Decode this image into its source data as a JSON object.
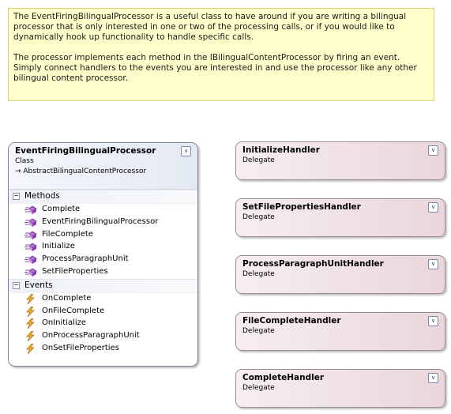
{
  "note": {
    "paragraphs": [
      "The EventFiringBilingualProcessor is a useful class to have around if you are writing a bilingual processor that is only interested in one or two of the processing calls, or if you would like to dynamically hook up functionality to handle specific calls.",
      "The processor implements each method in the IBilingualContentProcessor by firing an event. Simply connect handlers to the events you are interested in and use the processor like any other bilingual content processor."
    ]
  },
  "class_shape": {
    "name": "EventFiringBilingualProcessor",
    "stereotype": "Class",
    "base_class": "→ AbstractBilingualContentProcessor",
    "collapse_glyph": "∧",
    "sections": {
      "methods": {
        "label": "Methods",
        "toggle": "−",
        "items": [
          "Complete",
          "EventFiringBilingualProcessor",
          "FileComplete",
          "Initialize",
          "ProcessParagraphUnit",
          "SetFileProperties"
        ]
      },
      "events": {
        "label": "Events",
        "toggle": "−",
        "items": [
          "OnComplete",
          "OnFileComplete",
          "OnInitialize",
          "OnProcessParagraphUnit",
          "OnSetFileProperties"
        ]
      }
    },
    "icons": {
      "method": "method-icon",
      "event": "event-lightning-icon"
    }
  },
  "delegates": [
    {
      "name": "InitializeHandler",
      "type": "Delegate",
      "expand_glyph": "∨"
    },
    {
      "name": "SetFilePropertiesHandler",
      "type": "Delegate",
      "expand_glyph": "∨"
    },
    {
      "name": "ProcessParagraphUnitHandler",
      "type": "Delegate",
      "expand_glyph": "∨"
    },
    {
      "name": "FileCompleteHandler",
      "type": "Delegate",
      "expand_glyph": "∨"
    },
    {
      "name": "CompleteHandler",
      "type": "Delegate",
      "expand_glyph": "∨"
    }
  ],
  "colors": {
    "note_bg": "#ffffcc",
    "class_header": "#e3e9f4",
    "delegate_fill": "#e9d6da",
    "method_icon": "#9b59b6",
    "event_icon": "#e8a33a"
  }
}
